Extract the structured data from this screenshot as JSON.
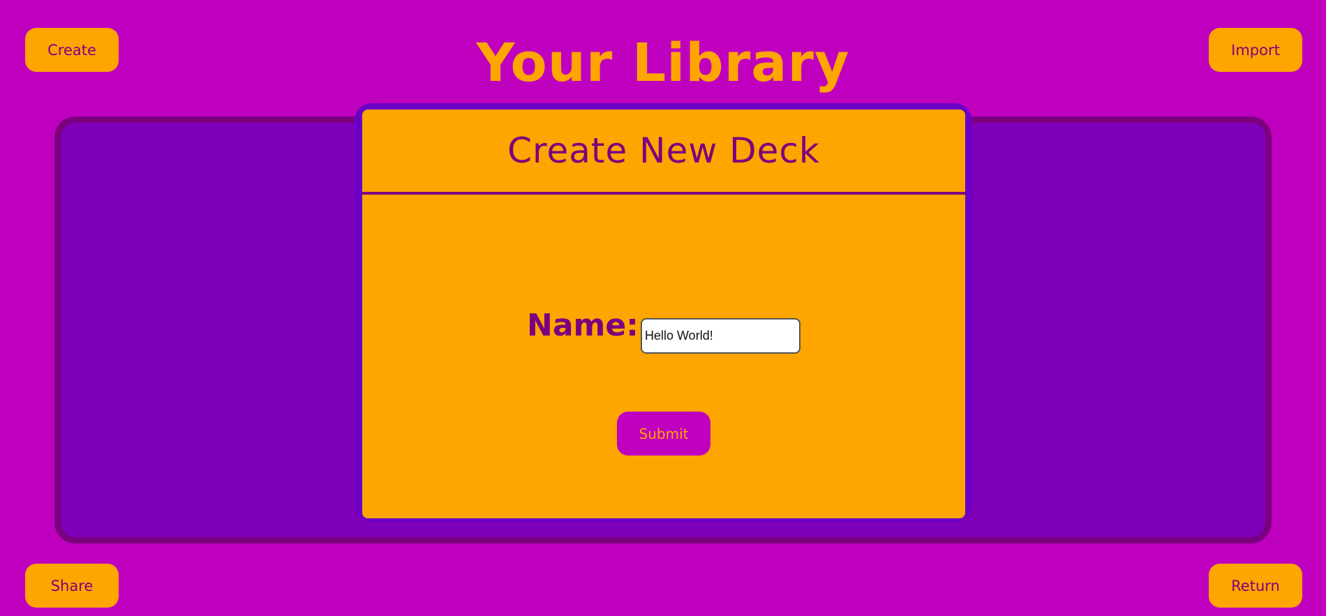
{
  "page": {
    "title": "Your Library"
  },
  "corner_buttons": {
    "create": "Create",
    "import": "Import",
    "share": "Share",
    "return": "Return"
  },
  "modal": {
    "title": "Create New Deck",
    "name_label": "Name:",
    "name_value": "Hello World!",
    "submit_label": "Submit"
  },
  "colors": {
    "background": "#bf00bf",
    "accent_orange": "#ffa500",
    "panel_purple": "#7e00b8",
    "text_purple": "#7b0080"
  }
}
